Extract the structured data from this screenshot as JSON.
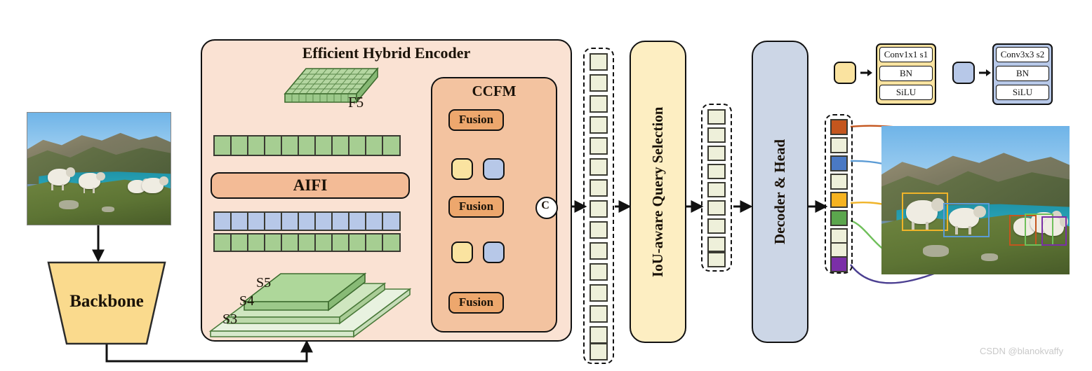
{
  "figure": {
    "watermark": "CSDN @blanokvaffy"
  },
  "backbone": {
    "label": "Backbone"
  },
  "encoder": {
    "title": "Efficient Hybrid Encoder",
    "aifi_label": "AIFI",
    "f5_label": "F5",
    "scale_labels": [
      "S5",
      "S4",
      "S3"
    ],
    "top_token_count": 11,
    "blue_token_count": 11,
    "green_token_count": 11
  },
  "ccfm": {
    "title": "CCFM",
    "fusion_labels": [
      "Fusion",
      "Fusion",
      "Fusion"
    ],
    "concat_label": "C"
  },
  "query_selection": {
    "label": "IoU-aware Query Selection"
  },
  "decoder": {
    "label": "Decoder & Head"
  },
  "token_columns": {
    "encoder_output_count": 15,
    "query_count": 9,
    "prediction_tokens": [
      {
        "color": "#c4561e",
        "active": true
      },
      {
        "color": "#eef0da",
        "active": false
      },
      {
        "color": "#4a79c4",
        "active": true
      },
      {
        "color": "#eef0da",
        "active": false
      },
      {
        "color": "#f6b320",
        "active": true
      },
      {
        "color": "#5ba64d",
        "active": true
      },
      {
        "color": "#eef0da",
        "active": false
      },
      {
        "color": "#eef0da",
        "active": false
      },
      {
        "color": "#7b2fa8",
        "active": true
      }
    ]
  },
  "legend": [
    {
      "swatch_color": "#fae3a0",
      "rows": [
        "Conv1x1 s1",
        "BN",
        "SiLU"
      ]
    },
    {
      "swatch_color": "#b7c8e8",
      "rows": [
        "Conv3x3 s2",
        "BN",
        "SiLU"
      ]
    }
  ],
  "detections": [
    {
      "name": "sheep-box-orange",
      "color": "#c4561e"
    },
    {
      "name": "sheep-box-blue",
      "color": "#5b9bd5"
    },
    {
      "name": "sheep-box-yellow",
      "color": "#f0b429"
    },
    {
      "name": "sheep-box-green",
      "color": "#6fbf5a"
    },
    {
      "name": "sheep-box-purple",
      "color": "#7b2fa8"
    }
  ],
  "colors": {
    "encoder_panel": "#fae2d3",
    "ccfm_panel": "#f3c3a0",
    "fusion": "#eda76d",
    "aifi": "#f3bb96",
    "yellow": "#fae3a0",
    "blue": "#b7c8e8",
    "green": "#a6ce92",
    "pale": "#eef0da",
    "backbone": "#fada8d",
    "query_panel": "#fdeec2",
    "decoder_panel": "#ccd6e6",
    "red_arrow": "#d1401c",
    "blue_arrow": "#2d7fd0"
  }
}
